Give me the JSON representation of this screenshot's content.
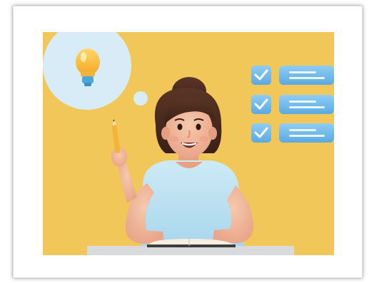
{
  "illustration": {
    "background_color": "#f1c75a",
    "thought_bubble_color": "#d8ecf7",
    "checkbox_color": "#6fb9ec",
    "shirt_color": "#bfe3f3",
    "desk_color": "#d9dadb",
    "icons": [
      "lightbulb-icon",
      "check-icon",
      "pencil-icon",
      "book-icon"
    ],
    "checklist_rows": [
      {
        "checked": true
      },
      {
        "checked": true
      },
      {
        "checked": true
      }
    ]
  }
}
